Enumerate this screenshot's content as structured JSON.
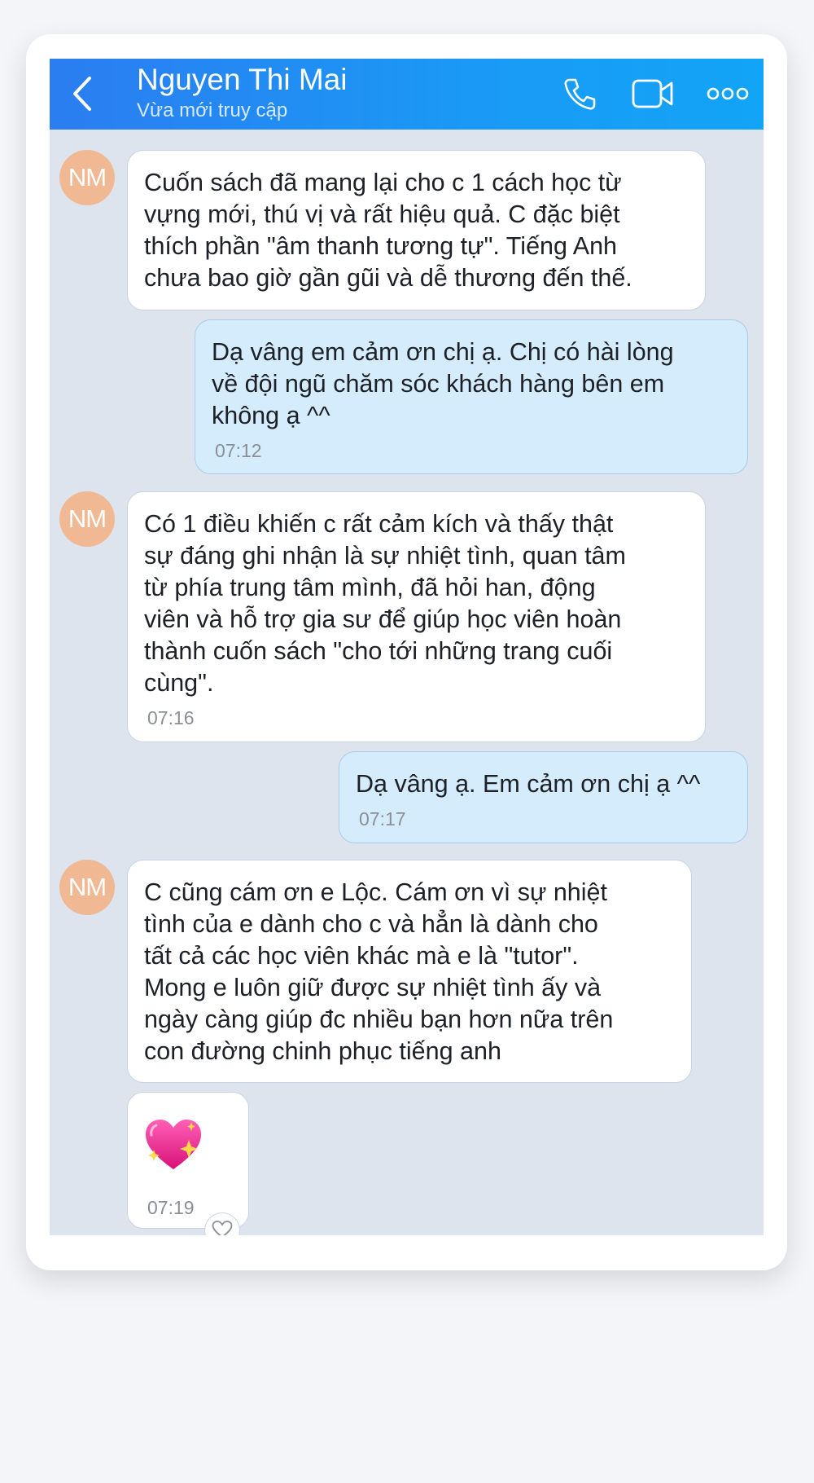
{
  "header": {
    "contact_name": "Nguyen Thi Mai",
    "status": "Vừa mới truy cập",
    "accent_color": "#1a9af6"
  },
  "avatar": {
    "initials": "NM",
    "color": "#f0b893"
  },
  "messages": [
    {
      "side": "incoming",
      "lines": [
        "Cuốn sách đã mang lại cho c 1 cách học từ",
        "vựng mới, thú vị và rất hiệu quả. C đặc biệt",
        "thích phần \"âm thanh tương tự\". Tiếng Anh",
        "chưa bao giờ gần gũi và dễ thương đến thế."
      ]
    },
    {
      "side": "outgoing",
      "lines": [
        "Dạ vâng em cảm ơn chị ạ. Chị có hài lòng",
        "về đội ngũ chăm sóc khách hàng bên em",
        "không ạ ^^"
      ],
      "time": "07:12"
    },
    {
      "side": "incoming",
      "lines": [
        "Có 1 điều khiến c rất cảm kích và thấy thật",
        "sự đáng ghi nhận là sự nhiệt tình, quan tâm",
        "từ phía trung tâm mình, đã hỏi han, động",
        "viên và hỗ trợ gia sư để giúp học viên hoàn",
        "thành cuốn sách \"cho tới những trang cuối",
        "cùng\"."
      ],
      "time": "07:16"
    },
    {
      "side": "outgoing",
      "lines": [
        "Dạ vâng ạ. Em cảm ơn chị ạ ^^"
      ],
      "time": "07:17"
    },
    {
      "side": "incoming",
      "lines": [
        "C cũng cám ơn e Lộc. Cám ơn vì sự nhiệt",
        "tình của e dành cho c và hẳn là dành cho",
        "tất cả các học viên khác mà e là \"tutor\".",
        "Mong e luôn giữ được sự nhiệt tình ấy và",
        "ngày càng giúp đc nhiều bạn hơn nữa trên",
        "con đường chinh phục tiếng anh"
      ]
    },
    {
      "side": "incoming",
      "sticker": "sparkling-heart-icon",
      "time": "07:19"
    }
  ]
}
